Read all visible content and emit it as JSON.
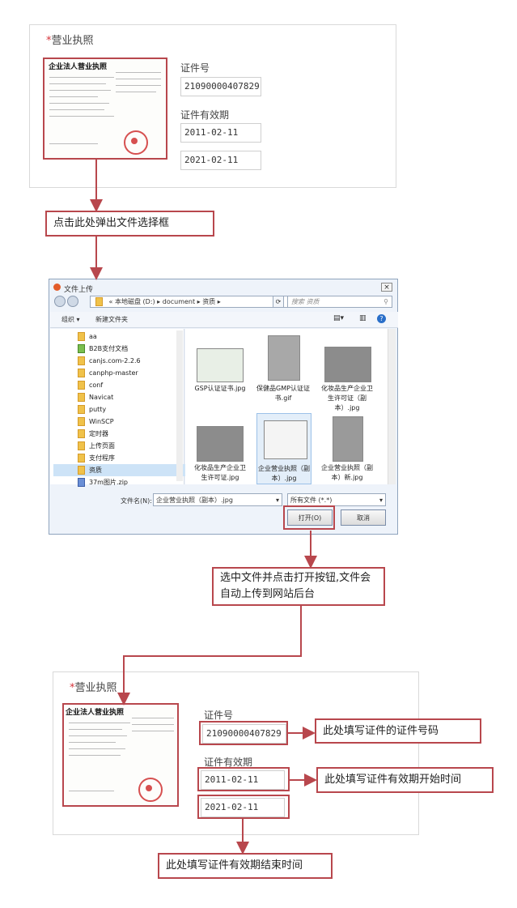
{
  "section_top": {
    "required_mark": "*",
    "title": "营业执照",
    "cert_no_label": "证件号",
    "cert_no_value": "21090000407829",
    "validity_label": "证件有效期",
    "start_date": "2011-02-11",
    "end_date": "2021-02-11"
  },
  "license_image": {
    "title": "企业法人营业执照"
  },
  "callouts": {
    "click_here": "点击此处弹出文件选择框",
    "select_upload": "选中文件并点击打开按钮,文件会自动上传到网站后台",
    "fill_cert_no": "此处填写证件的证件号码",
    "fill_start": "此处填写证件有效期开始时间",
    "fill_end": "此处填写证件有效期结束时间"
  },
  "dialog": {
    "title": "文件上传",
    "path": [
      "«",
      "本地磁盘 (D:)",
      "document",
      "资质"
    ],
    "search_placeholder": "搜索 资质",
    "toolbar_organize": "组织 ▾",
    "toolbar_new_folder": "新建文件夹",
    "tree": [
      "aa",
      "B2B支付文档",
      "canjs.com-2.2.6",
      "canphp-master",
      "conf",
      "Navicat",
      "putty",
      "WinSCP",
      "定时器",
      "上传页面",
      "支付程序",
      "资质",
      "37m图片.zip"
    ],
    "files": [
      "GSP认证证书.jpg",
      "保健品GMP认证证书.gif",
      "化妆品生产企业卫生许可证（副本）.jpg",
      "化妆品生产企业卫生许可证.jpg",
      "企业营业执照（副本）.jpg",
      "企业营业执照（副本）新.jpg"
    ],
    "filename_label": "文件名(N):",
    "filename_value": "企业营业执照（副本）.jpg",
    "filter_value": "所有文件 (*.*)",
    "open_button": "打开(O)",
    "cancel_button": "取消"
  },
  "section_bottom": {
    "required_mark": "*",
    "title": "营业执照",
    "cert_no_label": "证件号",
    "cert_no_value": "21090000407829",
    "validity_label": "证件有效期",
    "start_date": "2011-02-11",
    "end_date": "2021-02-11"
  },
  "colors": {
    "accent_red": "#b8474d",
    "required_red": "#d6343b",
    "dialog_bg": "#eef3fa"
  }
}
